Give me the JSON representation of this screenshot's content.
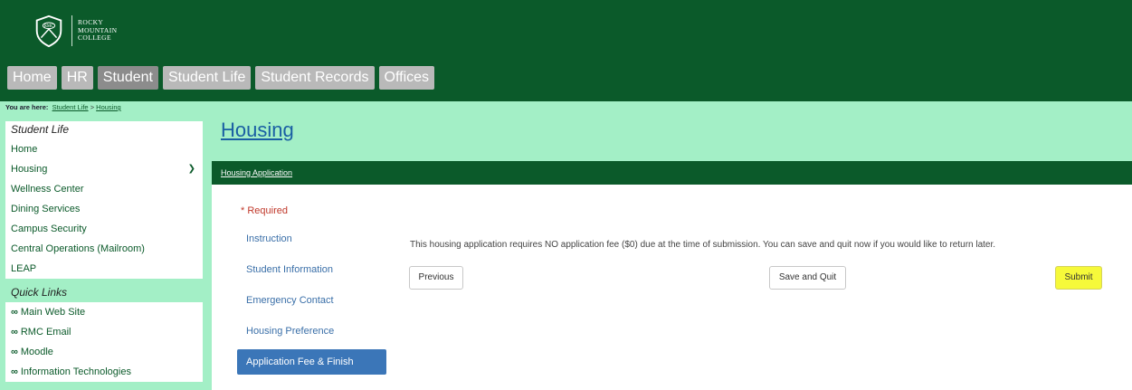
{
  "brand": {
    "line1": "Rocky",
    "line2": "Mountain",
    "line3": "College",
    "crest_text": "RMC"
  },
  "nav": [
    {
      "label": "Home",
      "active": false
    },
    {
      "label": "HR",
      "active": false
    },
    {
      "label": "Student",
      "active": true
    },
    {
      "label": "Student Life",
      "active": false
    },
    {
      "label": "Student Records",
      "active": false
    },
    {
      "label": "Offices",
      "active": false
    }
  ],
  "breadcrumb": {
    "prefix": "You are here:",
    "item1": "Student Life",
    "sep": ">",
    "item2": "Housing"
  },
  "sidebar": {
    "heading": "Student Life",
    "items": [
      "Home",
      "Housing",
      "Wellness Center",
      "Dining Services",
      "Campus Security",
      "Central Operations (Mailroom)",
      "LEAP"
    ],
    "quick_links_heading": "Quick Links",
    "quick_links": [
      "Main Web Site",
      "RMC Email",
      "Moodle",
      "Information Technologies"
    ]
  },
  "page": {
    "title": "Housing",
    "section": "Housing Application",
    "required": "* Required",
    "steps": [
      "Instruction",
      "Student Information",
      "Emergency Contact",
      "Housing Preference",
      "Application Fee & Finish"
    ],
    "active_step": "Application Fee & Finish",
    "info": "This housing application requires NO application fee ($0) due at the time of submission. You can save and quit now if you would like to return later.",
    "buttons": {
      "previous": "Previous",
      "save": "Save and Quit",
      "submit": "Submit"
    }
  },
  "colors": {
    "header": "#0b5a2a",
    "band": "#a3efc6",
    "active_step": "#3b76b8",
    "submit": "#f6f93a"
  }
}
